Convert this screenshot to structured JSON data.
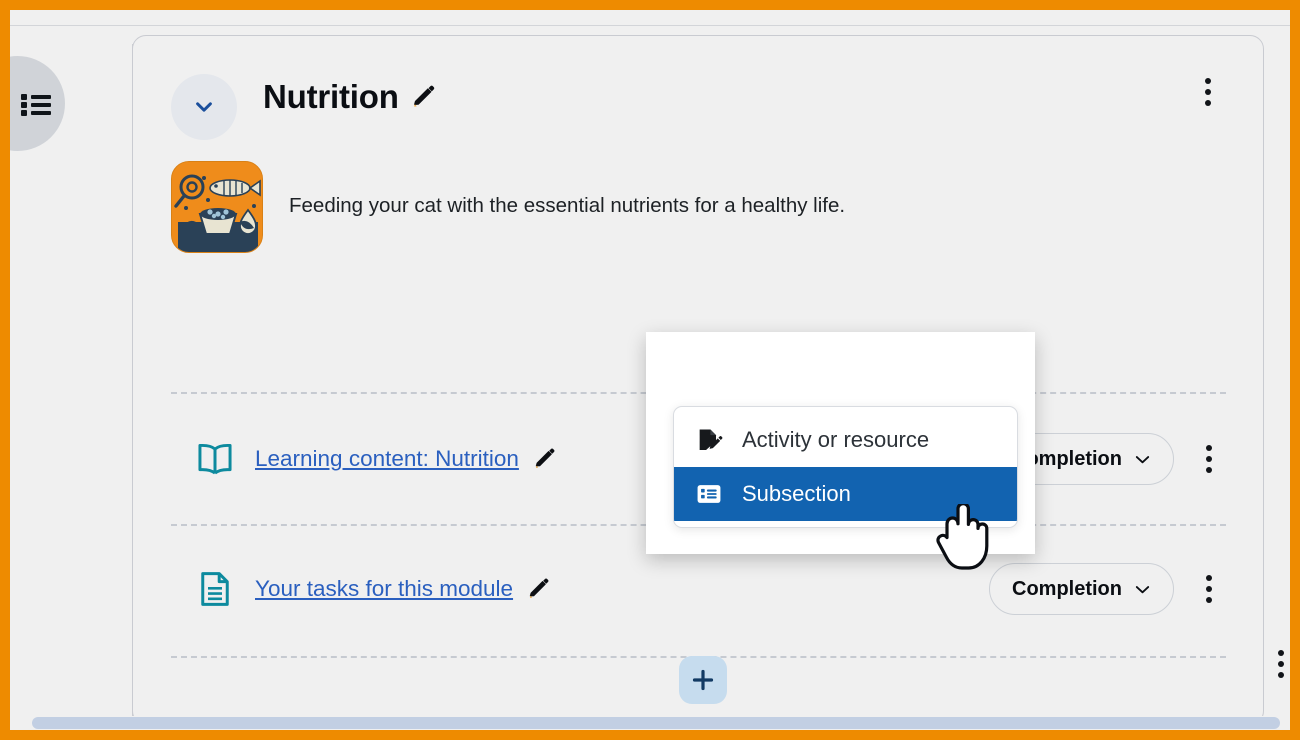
{
  "theme": {
    "border_color": "#ee8b00",
    "page_bg": "#f0f0f0",
    "link_color": "#2a5fbf",
    "icon_teal": "#0d8a9e",
    "accent_blue": "#1263b0",
    "add_button_bg": "#c6dcee",
    "thumb_orange": "#ef8c1b"
  },
  "drawer": {
    "toggle_icon": "list-icon",
    "toggle_label": "Open course index"
  },
  "section": {
    "title": "Nutrition",
    "title_edit_icon": "pencil-icon",
    "collapse_icon": "chevron-down-icon",
    "menu_icon": "kebab-menu-icon",
    "thumbnail_alt": "cat-nutrition-thumbnail",
    "description": "Feeding your cat with the essential nutrients for a healthy life."
  },
  "activities": [
    {
      "icon": "book-icon",
      "name": "Learning content: Nutrition",
      "edit_icon": "pencil-icon",
      "completion_label": "Completion",
      "completion_chevron": "chevron-down-icon",
      "menu_icon": "kebab-menu-icon"
    },
    {
      "icon": "page-icon",
      "name": "Your tasks for this module",
      "edit_icon": "pencil-icon",
      "completion_label": "Completion",
      "completion_chevron": "chevron-down-icon",
      "menu_icon": "kebab-menu-icon"
    }
  ],
  "add_buttons": {
    "top_label": "+",
    "bottom_label": "+",
    "icon": "plus-icon"
  },
  "add_popup": {
    "open": true,
    "items": [
      {
        "label": "Activity or resource",
        "icon": "document-edit-icon",
        "selected": false
      },
      {
        "label": "Subsection",
        "icon": "list-blocks-icon",
        "selected": true
      }
    ]
  },
  "cursor": {
    "type": "pointer-hand-cursor"
  }
}
